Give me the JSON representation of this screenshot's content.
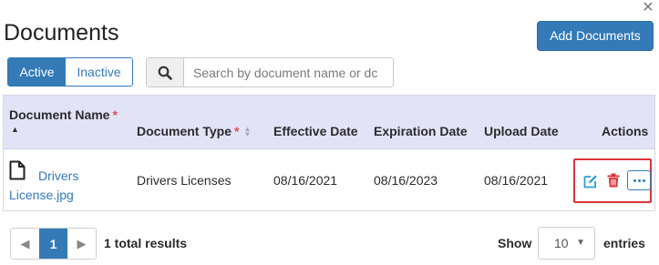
{
  "header": {
    "title": "Documents",
    "add_button": "Add Documents",
    "close_glyph": "✕"
  },
  "filter": {
    "active_label": "Active",
    "inactive_label": "Inactive",
    "selected": "Active"
  },
  "search": {
    "placeholder": "Search by document name or dc",
    "value": "",
    "icon": "search-icon"
  },
  "table": {
    "columns": [
      {
        "label": "Document Name",
        "required": true,
        "sort": "asc"
      },
      {
        "label": "Document Type",
        "required": true,
        "sort": "none"
      },
      {
        "label": "Effective Date"
      },
      {
        "label": "Expiration Date"
      },
      {
        "label": "Upload Date"
      },
      {
        "label": "Actions"
      }
    ],
    "required_marker": "*",
    "rows": [
      {
        "document_name": "Drivers License.jpg",
        "document_type": "Drivers Licenses",
        "effective_date": "08/16/2021",
        "expiration_date": "08/16/2023",
        "upload_date": "08/16/2021",
        "actions": [
          "edit-icon",
          "trash-icon",
          "more-icon"
        ]
      }
    ]
  },
  "pagination": {
    "prev_glyph": "◀",
    "current_page": "1",
    "next_glyph": "▶",
    "total_text": "1 total results"
  },
  "page_size": {
    "show_label": "Show",
    "selected": "10",
    "entries_label": "entries"
  },
  "colors": {
    "primary": "#337ab7",
    "header_bg": "#e3e3f7",
    "required": "#d9534f",
    "delete": "#d9343a",
    "edit": "#2a9fd8",
    "highlight": "#d9343a"
  }
}
